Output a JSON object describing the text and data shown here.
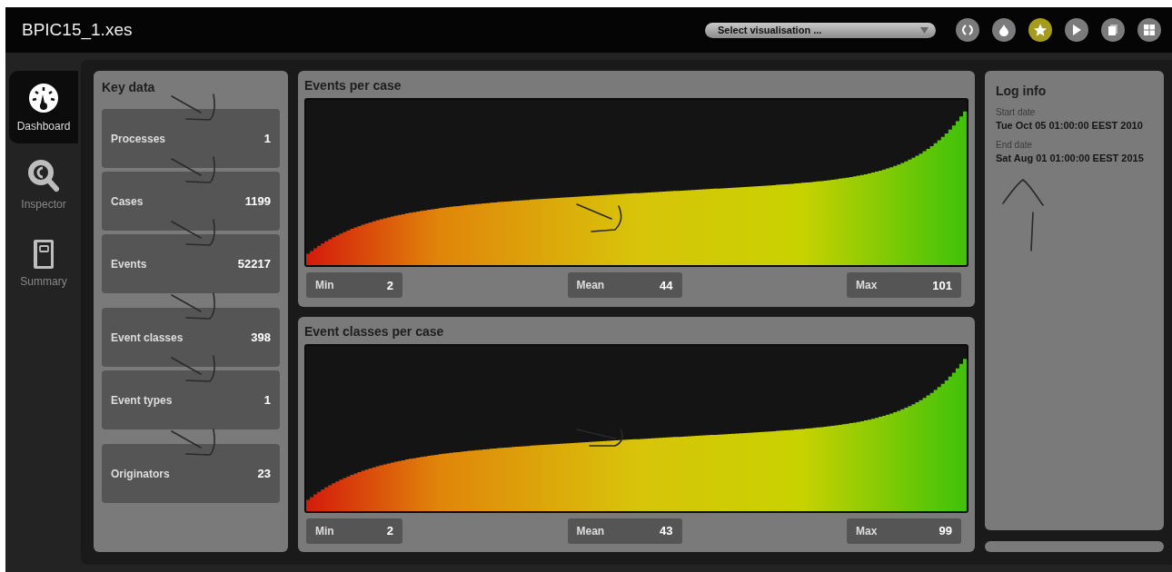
{
  "file_title": "BPIC15_1.xes",
  "visualisation_select": {
    "placeholder": "Select visualisation ..."
  },
  "toolbar": [
    {
      "kind": "brackets",
      "selected": false
    },
    {
      "kind": "drop",
      "selected": false
    },
    {
      "kind": "star",
      "selected": true
    },
    {
      "kind": "play",
      "selected": false
    },
    {
      "kind": "copy",
      "selected": false
    },
    {
      "kind": "grid",
      "selected": false
    }
  ],
  "sidebar": {
    "items": [
      {
        "kind": "gauge",
        "label": "Dashboard",
        "selected": true
      },
      {
        "kind": "inspect",
        "label": "Inspector",
        "selected": false
      },
      {
        "kind": "book",
        "label": "Summary",
        "selected": false
      }
    ]
  },
  "key_data": {
    "title": "Key data",
    "groups": [
      {
        "items": [
          {
            "label": "Processes",
            "value": "1"
          },
          {
            "label": "Cases",
            "value": "1199"
          },
          {
            "label": "Events",
            "value": "52217"
          }
        ]
      },
      {
        "items": [
          {
            "label": "Event classes",
            "value": "398"
          },
          {
            "label": "Event types",
            "value": "1"
          }
        ]
      },
      {
        "items": [
          {
            "label": "Originators",
            "value": "23"
          }
        ]
      }
    ]
  },
  "charts": [
    {
      "title": "Events per case",
      "stats": [
        {
          "label": "Min",
          "value": "2"
        },
        {
          "label": "Mean",
          "value": "44"
        },
        {
          "label": "Max",
          "value": "101"
        }
      ]
    },
    {
      "title": "Event classes per case",
      "stats": [
        {
          "label": "Min",
          "value": "2"
        },
        {
          "label": "Mean",
          "value": "43"
        },
        {
          "label": "Max",
          "value": "99"
        }
      ]
    }
  ],
  "log_info": {
    "title": "Log info",
    "fields": [
      {
        "label": "Start date",
        "value": "Tue Oct 05 01:00:00 EEST 2010"
      },
      {
        "label": "End date",
        "value": "Sat Aug 01 01:00:00 EEST 2015"
      }
    ]
  }
}
